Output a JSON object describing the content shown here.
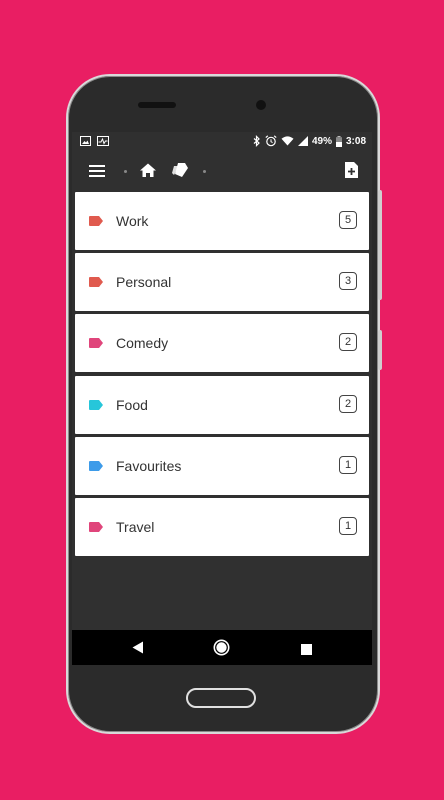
{
  "status_bar": {
    "battery": "49%",
    "time": "3:08",
    "icons_left": [
      "image-icon",
      "activity-icon"
    ],
    "icons_right": [
      "bluetooth-icon",
      "alarm-icon",
      "wifi-icon",
      "signal-icon",
      "battery-icon"
    ]
  },
  "toolbar": {
    "icons": [
      "menu-icon",
      "home-icon",
      "tags-icon",
      "new-note-icon"
    ]
  },
  "tags": [
    {
      "label": "Work",
      "count": "5",
      "color": "#e05a4e"
    },
    {
      "label": "Personal",
      "count": "3",
      "color": "#e05a4e"
    },
    {
      "label": "Comedy",
      "count": "2",
      "color": "#e0457b"
    },
    {
      "label": "Food",
      "count": "2",
      "color": "#26c6da"
    },
    {
      "label": "Favourites",
      "count": "1",
      "color": "#3d9be9"
    },
    {
      "label": "Travel",
      "count": "1",
      "color": "#e0457b"
    }
  ],
  "nav_bar": {
    "icons": [
      "back-icon",
      "home-circle-icon",
      "recents-icon"
    ]
  },
  "colors": {
    "background": "#e91e63",
    "screen": "#303030",
    "card": "#ffffff"
  }
}
